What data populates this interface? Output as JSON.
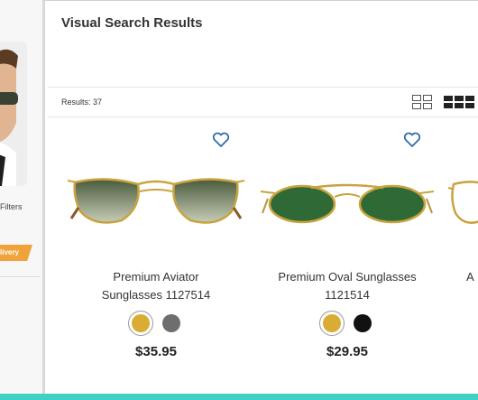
{
  "sidebar": {
    "filters_label": "Filters",
    "delivery_badge": "livery"
  },
  "header": {
    "title": "Visual Search Results"
  },
  "toolbar": {
    "results": "Results: 37",
    "views": [
      "grid-2-icon",
      "grid-3-icon"
    ]
  },
  "products": [
    {
      "name_line1": "Premium Aviator",
      "name_line2": "Sunglasses 1127514",
      "price": "$35.95",
      "swatches": [
        "#d9ac33",
        "#6e6e6e"
      ],
      "selected_swatch": 0,
      "lens_color": "#5c6e4c",
      "frame_color": "#c9a33f"
    },
    {
      "name_line1": "Premium Oval Sunglasses",
      "name_line2": "1121514",
      "price": "$29.95",
      "swatches": [
        "#d9ac33",
        "#111111"
      ],
      "selected_swatch": 0,
      "lens_color": "#2f6a36",
      "frame_color": "#c9a33f"
    },
    {
      "name_line1": "A",
      "name_line2": "",
      "price": "",
      "swatches": [],
      "lens_color": "#ffffff",
      "frame_color": "#c9a33f"
    }
  ],
  "colors": {
    "accent_bar": "#3fd1c4",
    "heart": "#2f6ea8",
    "badge": "#f2a23a"
  }
}
